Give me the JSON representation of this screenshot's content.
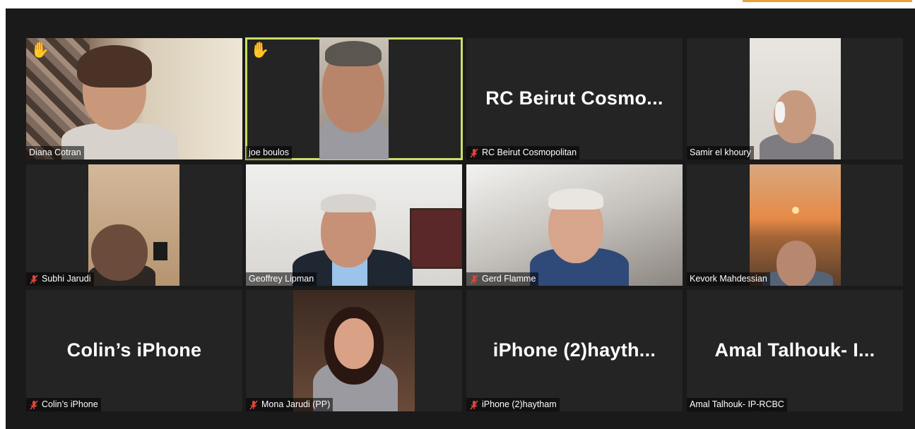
{
  "participants": [
    {
      "name": "Diana Cotran",
      "muted": false,
      "raised_hand": true,
      "video": true
    },
    {
      "name": "joe boulos",
      "muted": false,
      "raised_hand": true,
      "video": true,
      "active_speaker": true
    },
    {
      "name": "RC Beirut Cosmopolitan",
      "display_title": "RC Beirut Cosmo...",
      "muted": true,
      "video": false
    },
    {
      "name": "Samir el khoury",
      "muted": false,
      "video": true
    },
    {
      "name": "Subhi Jarudi",
      "muted": true,
      "video": true
    },
    {
      "name": "Geoffrey Lipman",
      "muted": false,
      "video": true
    },
    {
      "name": "Gerd Flamme",
      "muted": true,
      "video": true
    },
    {
      "name": "Kevork Mahdessian",
      "muted": false,
      "video": true
    },
    {
      "name": "Colin’s iPhone",
      "display_title": "Colin’s iPhone",
      "muted": true,
      "video": false
    },
    {
      "name": "Mona Jarudi (PP)",
      "muted": true,
      "video": true
    },
    {
      "name": "iPhone (2)haytham",
      "display_title": "iPhone  (2)hayth...",
      "muted": true,
      "video": false
    },
    {
      "name": "Amal Talhouk- IP-RCBC",
      "display_title": "Amal  Talhouk-  I...",
      "muted": false,
      "video": false
    }
  ],
  "colors": {
    "stage_bg": "#1a1a1a",
    "tile_bg": "#242424",
    "active_border": "#c8e06a",
    "mic_off": "#e0453a",
    "raised_hand": "#f2b21f"
  },
  "icons": {
    "raised_hand": "raised-hand-icon",
    "mic_off": "mic-off-icon"
  }
}
